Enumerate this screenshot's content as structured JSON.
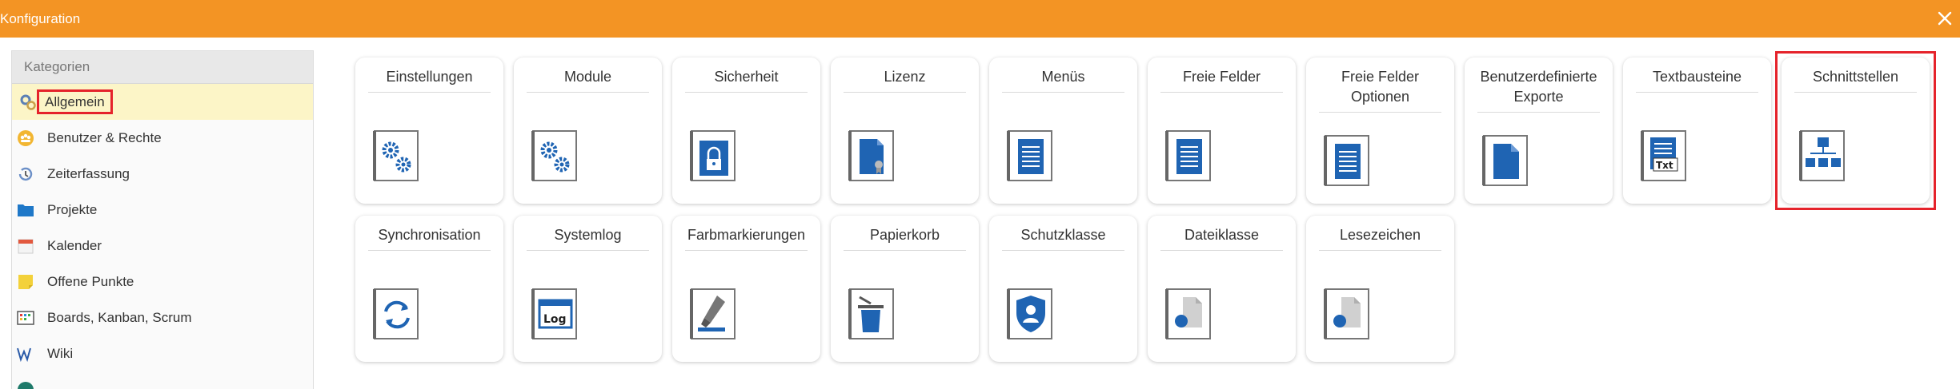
{
  "window": {
    "title": "Konfiguration",
    "accent_color": "#f39424",
    "highlight_color": "#e5232b",
    "icon_blue": "#1f64b3"
  },
  "sidebar": {
    "header": "Kategorien",
    "items": [
      {
        "label": "Allgemein",
        "icon": "gear-wrench-icon",
        "active": true
      },
      {
        "label": "Benutzer & Rechte",
        "icon": "users-icon"
      },
      {
        "label": "Zeiterfassung",
        "icon": "clock-history-icon"
      },
      {
        "label": "Projekte",
        "icon": "folder-icon"
      },
      {
        "label": "Kalender",
        "icon": "calendar-icon"
      },
      {
        "label": "Offene Punkte",
        "icon": "sticky-note-icon"
      },
      {
        "label": "Boards, Kanban, Scrum",
        "icon": "kanban-board-icon"
      },
      {
        "label": "Wiki",
        "icon": "wiki-icon"
      }
    ]
  },
  "tiles": [
    {
      "label": "Einstellungen",
      "icon": "gears-icon"
    },
    {
      "label": "Module",
      "icon": "gears-icon"
    },
    {
      "label": "Sicherheit",
      "icon": "lock-icon"
    },
    {
      "label": "Lizenz",
      "icon": "license-document-icon"
    },
    {
      "label": "Menüs",
      "icon": "list-document-icon"
    },
    {
      "label": "Freie Felder",
      "icon": "list-document-icon"
    },
    {
      "label": "Freie Felder Optionen",
      "icon": "list-document-icon"
    },
    {
      "label": "Benutzerdefinierte Exporte",
      "icon": "document-icon"
    },
    {
      "label": "Textbausteine",
      "icon": "text-document-icon",
      "icon_text": "Txt"
    },
    {
      "label": "Schnittstellen",
      "icon": "hierarchy-icon",
      "highlighted": true
    },
    {
      "label": "Synchronisation",
      "icon": "sync-icon"
    },
    {
      "label": "Systemlog",
      "icon": "log-icon",
      "icon_text": "Log"
    },
    {
      "label": "Farbmarkierungen",
      "icon": "marker-icon"
    },
    {
      "label": "Papierkorb",
      "icon": "trash-icon"
    },
    {
      "label": "Schutzklasse",
      "icon": "shield-user-icon"
    },
    {
      "label": "Dateiklasse",
      "icon": "file-class-icon"
    },
    {
      "label": "Lesezeichen",
      "icon": "bookmark-file-icon"
    }
  ]
}
